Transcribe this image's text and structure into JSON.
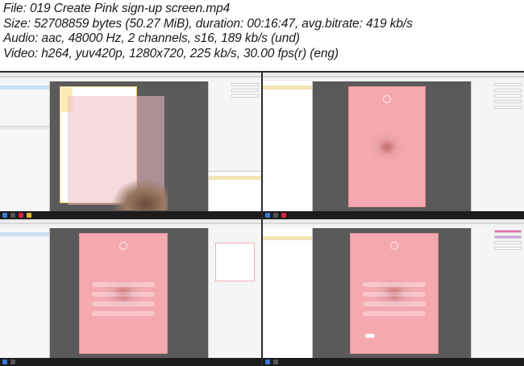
{
  "header": {
    "file": "File: 019 Create Pink sign-up screen.mp4",
    "size": "Size: 52708859 bytes (50.27 MiB), duration: 00:16:47, avg.bitrate: 419 kb/s",
    "audio": "Audio: aac, 48000 Hz, 2 channels, s16, 189 kb/s (und)",
    "video": "Video: h264, yuv420p, 1280x720, 225 kb/s, 30.00 fps(r) (eng)"
  },
  "colors": {
    "accent_pink": "#f4a9ae",
    "selection": "#f0c66a",
    "taskbar": "#1c1c1c"
  },
  "icons": [
    "windows-logo-icon",
    "app-icon"
  ]
}
